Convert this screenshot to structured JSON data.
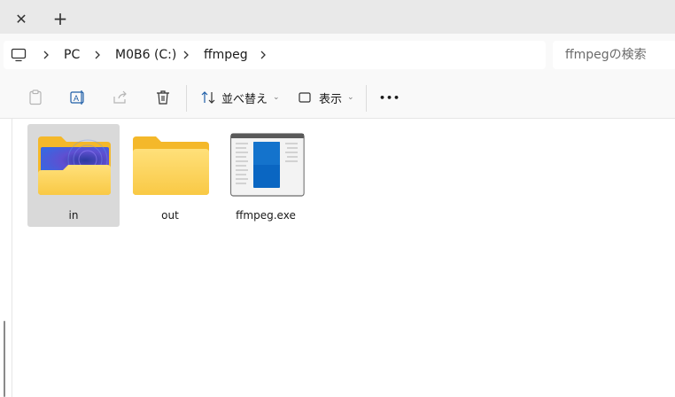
{
  "tabs": {
    "close_glyph": "✕",
    "new_glyph": "+"
  },
  "breadcrumb": {
    "items": [
      "PC",
      "M0B6 (C:)",
      "ffmpeg"
    ]
  },
  "search": {
    "placeholder": "ffmpegの検索"
  },
  "toolbar": {
    "sort_label": "並べ替え",
    "view_label": "表示",
    "more_label": "•••"
  },
  "files": [
    {
      "name": "in",
      "type": "folder-with-content",
      "selected": true
    },
    {
      "name": "out",
      "type": "folder",
      "selected": false
    },
    {
      "name": "ffmpeg.exe",
      "type": "executable",
      "selected": false
    }
  ],
  "colors": {
    "folder_back": "#f4b82a",
    "folder_front": "#ffd766",
    "selection": "#d9d9d9",
    "accent_blue": "#0a66c2"
  }
}
